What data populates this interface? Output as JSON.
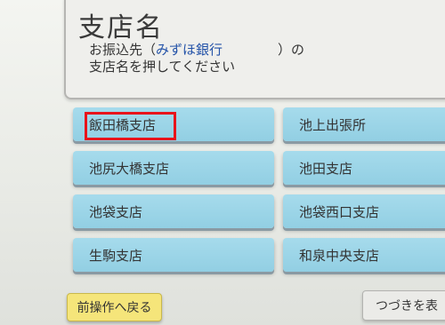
{
  "header": {
    "title": "支店名",
    "line1_prefix": "お振込先（",
    "bank_name": "みずほ銀行",
    "line1_suffix": "）の",
    "line2": "支店名を押してください"
  },
  "branches": [
    {
      "label": "飯田橋支店",
      "selected": true
    },
    {
      "label": "池上出張所"
    },
    {
      "label": "池尻大橋支店"
    },
    {
      "label": "池田支店"
    },
    {
      "label": "池袋支店"
    },
    {
      "label": "池袋西口支店"
    },
    {
      "label": "生駒支店"
    },
    {
      "label": "和泉中央支店"
    }
  ],
  "footer": {
    "back_label": "前操作へ戻る",
    "next_label": "つづきを表"
  },
  "colors": {
    "branch_button": "#9fd6e8",
    "highlight": "#e8141b",
    "back_button": "#f5e57a",
    "bank_text": "#2352a8"
  }
}
